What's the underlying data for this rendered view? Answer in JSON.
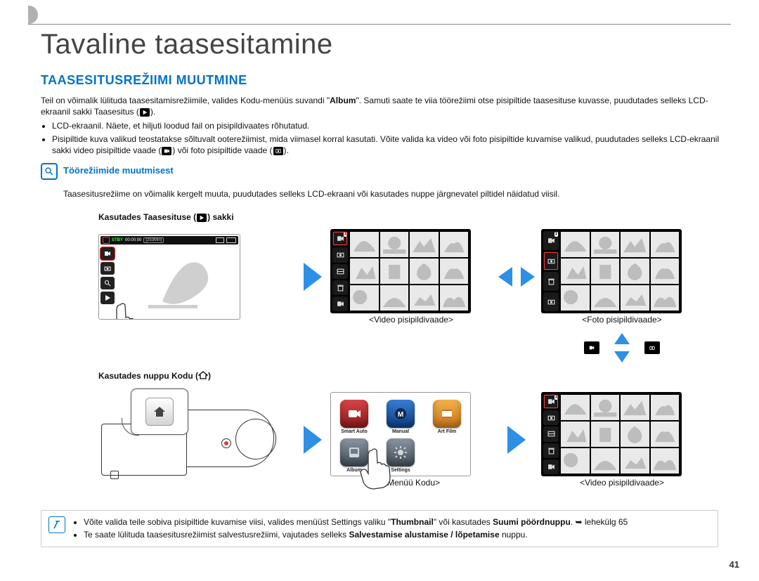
{
  "page": {
    "title": "Tavaline taasesitamine",
    "subtitle": "TAASESITUSREŽIIMI MUUTMINE",
    "number": "41"
  },
  "intro": {
    "p1a": "Teil on võimalik lülituda taasesitamisrežiimile, valides Kodu-menüüs suvandi \"",
    "p1_bold": "Album",
    "p1b": "\". Samuti saate te viia töörežiimi otse pisipiltide taasesituse kuvasse, puudutades selleks LCD-ekraanil sakki Taasesitus (",
    "p1c": ").",
    "bullet1": "LCD-ekraanil. Näete, et hiljuti loodud fail on pisipildivaates rõhutatud.",
    "bullet2a": "Pisipiltide kuva valikud teostatakse sõltuvalt ooterežiimist, mida viimasel korral kasutati. Võite valida ka video või foto pisipiltide kuvamise valikud, puudutades selleks LCD-ekraanil sakki video pisipiltide vaade (",
    "bullet2b": ") või foto pisipiltide vaade (",
    "bullet2c": ")."
  },
  "info": {
    "heading": "Töörežiimide muutmisest",
    "text": "Taasesitusrežiime on võimalik kergelt muuta, puudutades selleks LCD-ekraani või kasutades nuppe järgnevatel piltidel näidatud viisil."
  },
  "figures": {
    "row1_title_a": "Kasutades Taasesituse (",
    "row1_title_b": ") sakki",
    "row2_title_a": "Kasutades nuppu Kodu (",
    "row2_title_b": ")",
    "caption_video_thumb": "<Video pisipildivaade>",
    "caption_photo_thumb": "<Foto pisipildivaade>",
    "caption_menu_home": "<Menüü Kodu>",
    "lcd": {
      "status": "STBY",
      "time": "00:00:00",
      "remain": "[253Min]"
    }
  },
  "menu": {
    "items": [
      {
        "label": "Smart Auto",
        "bg": "#b32020"
      },
      {
        "label": "Manual",
        "bg": "#1560b5"
      },
      {
        "label": "Art Film",
        "bg": "#e08a1a"
      },
      {
        "label": "Album",
        "bg": "#5a6670"
      },
      {
        "label": "Settings",
        "bg": "#5a6670"
      }
    ]
  },
  "tips": {
    "t1a": "Võite valida teile sobiva pisipiltide kuvamise viisi, valides menüüst Settings valiku \"",
    "t1_bold1": "Thumbnail",
    "t1b": "\" või kasutades ",
    "t1_bold2": "Suumi pöördnuppu",
    "t1c": ". ",
    "t1_arrow": "➥",
    "t1d": " lehekülg 65",
    "t2a": "Te saate lülituda taasesitusrežiimist salvestusrežiimi, vajutades selleks ",
    "t2_bold": "Salvestamise alustamise / lõpetamise",
    "t2b": " nuppu."
  }
}
